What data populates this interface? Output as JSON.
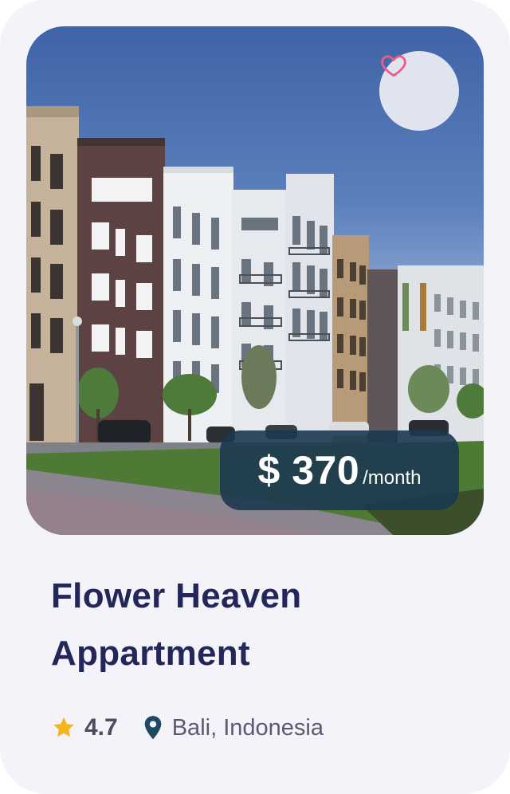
{
  "listing": {
    "price_amount": "$ 370",
    "price_unit": "/month",
    "title": "Flower Heaven Appartment",
    "rating": "4.7",
    "location": "Bali, Indonesia"
  },
  "icons": {
    "favorite": "heart-icon",
    "rating": "star-icon",
    "location": "location-pin-icon"
  },
  "colors": {
    "heart": "#ef5a8a",
    "star": "#f6b51e",
    "pin": "#1f4a63",
    "title": "#232659",
    "price_badge": "#1c3850"
  }
}
